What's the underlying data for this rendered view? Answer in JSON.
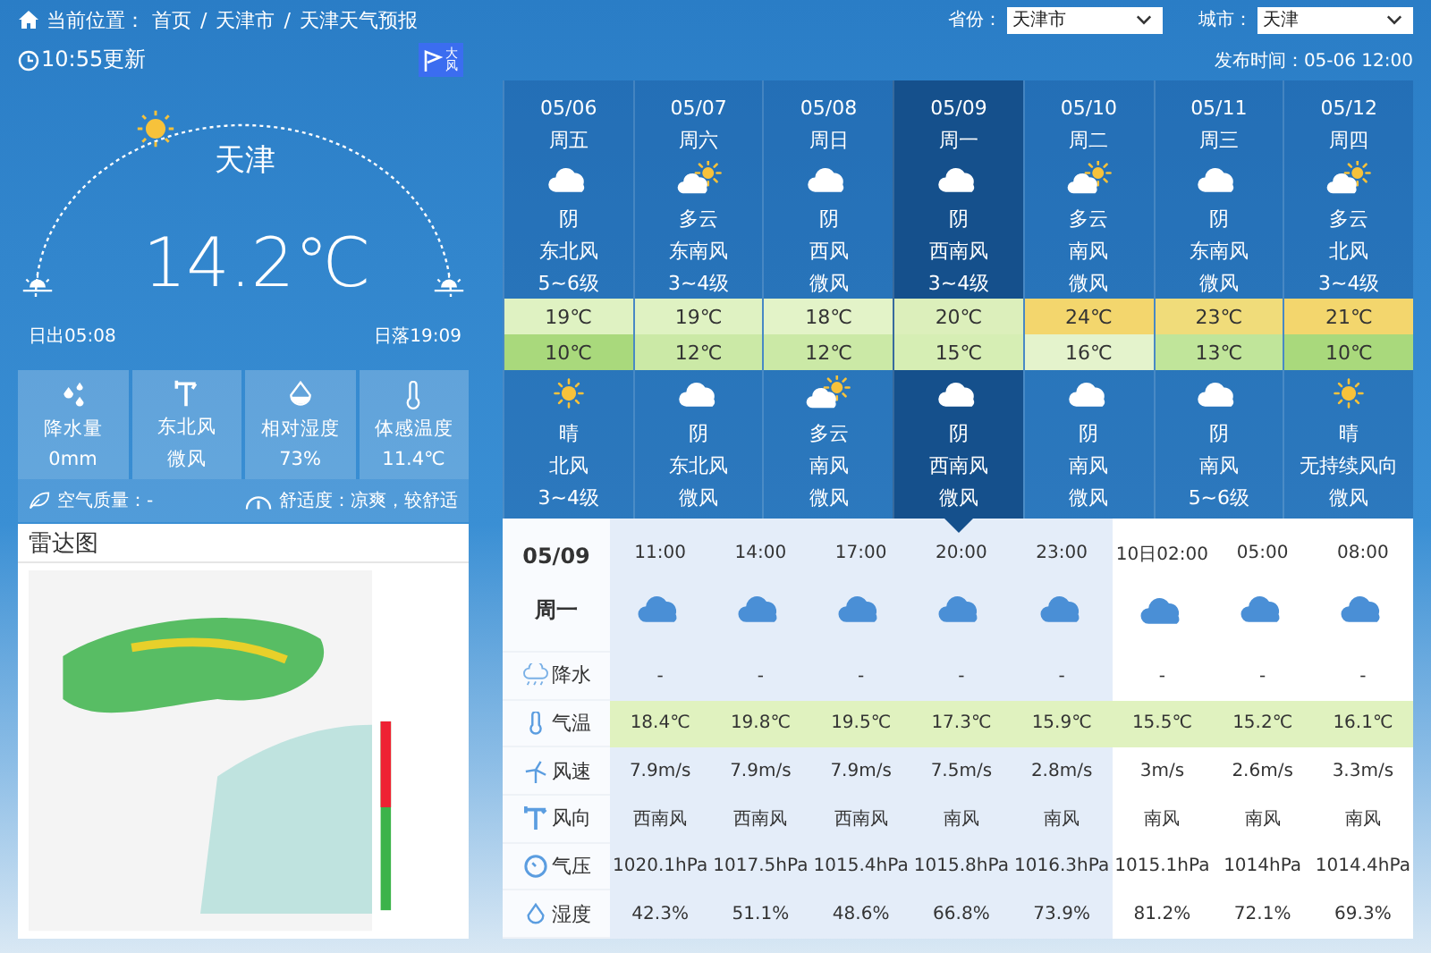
{
  "breadcrumb": {
    "label": "当前位置：",
    "items": [
      "首页",
      "天津市",
      "天津天气预报"
    ],
    "separator": "/"
  },
  "selects": [
    {
      "label": "省份：",
      "value": "天津市"
    },
    {
      "label": "城市：",
      "value": "天津"
    }
  ],
  "update_time": "10:55更新",
  "warning": {
    "text": "大风"
  },
  "publish_time": "发布时间：05-06 12:00",
  "current": {
    "city": "天津",
    "temperature": "14.2℃",
    "sunrise": "日出05:08",
    "sunset": "日落19:09"
  },
  "stats": [
    {
      "kind": "rain",
      "label": "降水量",
      "value": "0mm"
    },
    {
      "kind": "wind",
      "label": "东北风",
      "value": "微风"
    },
    {
      "kind": "humidity",
      "label": "相对湿度",
      "value": "73%"
    },
    {
      "kind": "feel",
      "label": "体感温度",
      "value": "11.4℃"
    }
  ],
  "air_quality": "空气质量：-",
  "comfort": "舒适度：凉爽，较舒适",
  "radar": {
    "title": "雷达图"
  },
  "days": [
    {
      "date": "05/06",
      "weekday": "周五",
      "selected": false,
      "day": {
        "kind": "cloudy",
        "weather": "阴",
        "wind_dir": "东北风",
        "wind_level": "5~6级"
      },
      "high": {
        "text": "19℃",
        "color": "#dff2c2"
      },
      "low": {
        "text": "10℃",
        "color": "#a9d97c"
      },
      "night": {
        "kind": "sunny",
        "weather": "晴",
        "wind_dir": "北风",
        "wind_level": "3~4级"
      }
    },
    {
      "date": "05/07",
      "weekday": "周六",
      "selected": false,
      "day": {
        "kind": "partly_cloudy",
        "weather": "多云",
        "wind_dir": "东南风",
        "wind_level": "3~4级"
      },
      "high": {
        "text": "19℃",
        "color": "#dff2c2"
      },
      "low": {
        "text": "12℃",
        "color": "#cbe9a6"
      },
      "night": {
        "kind": "cloudy",
        "weather": "阴",
        "wind_dir": "东北风",
        "wind_level": "微风"
      }
    },
    {
      "date": "05/08",
      "weekday": "周日",
      "selected": false,
      "day": {
        "kind": "cloudy",
        "weather": "阴",
        "wind_dir": "西风",
        "wind_level": "微风"
      },
      "high": {
        "text": "18℃",
        "color": "#e3f3c8"
      },
      "low": {
        "text": "12℃",
        "color": "#cbe9a6"
      },
      "night": {
        "kind": "partly_cloudy",
        "weather": "多云",
        "wind_dir": "南风",
        "wind_level": "微风"
      }
    },
    {
      "date": "05/09",
      "weekday": "周一",
      "selected": true,
      "day": {
        "kind": "cloudy",
        "weather": "阴",
        "wind_dir": "西南风",
        "wind_level": "3~4级"
      },
      "high": {
        "text": "20℃",
        "color": "#dcefbb"
      },
      "low": {
        "text": "15℃",
        "color": "#d6eeb4"
      },
      "night": {
        "kind": "cloudy",
        "weather": "阴",
        "wind_dir": "西南风",
        "wind_level": "微风"
      }
    },
    {
      "date": "05/10",
      "weekday": "周二",
      "selected": false,
      "day": {
        "kind": "partly_cloudy",
        "weather": "多云",
        "wind_dir": "南风",
        "wind_level": "微风"
      },
      "high": {
        "text": "24℃",
        "color": "#f3d66d"
      },
      "low": {
        "text": "16℃",
        "color": "#e4f3cc"
      },
      "night": {
        "kind": "cloudy",
        "weather": "阴",
        "wind_dir": "南风",
        "wind_level": "微风"
      }
    },
    {
      "date": "05/11",
      "weekday": "周三",
      "selected": false,
      "day": {
        "kind": "cloudy",
        "weather": "阴",
        "wind_dir": "东南风",
        "wind_level": "微风"
      },
      "high": {
        "text": "23℃",
        "color": "#f0dc7a"
      },
      "low": {
        "text": "13℃",
        "color": "#c0e59a"
      },
      "night": {
        "kind": "cloudy",
        "weather": "阴",
        "wind_dir": "南风",
        "wind_level": "5~6级"
      }
    },
    {
      "date": "05/12",
      "weekday": "周四",
      "selected": false,
      "day": {
        "kind": "partly_cloudy",
        "weather": "多云",
        "wind_dir": "北风",
        "wind_level": "3~4级"
      },
      "high": {
        "text": "21℃",
        "color": "#f3d66d"
      },
      "low": {
        "text": "10℃",
        "color": "#a9d97c"
      },
      "night": {
        "kind": "sunny",
        "weather": "晴",
        "wind_dir": "无持续风向",
        "wind_level": "微风"
      }
    }
  ],
  "hourly": {
    "date": "05/09",
    "weekday": "周一",
    "columns": [
      {
        "time": "11:00",
        "kind": "cloudy",
        "selected_day": true
      },
      {
        "time": "14:00",
        "kind": "cloudy",
        "selected_day": true
      },
      {
        "time": "17:00",
        "kind": "cloudy",
        "selected_day": true
      },
      {
        "time": "20:00",
        "kind": "cloudy",
        "selected_day": true
      },
      {
        "time": "23:00",
        "kind": "cloudy",
        "selected_day": true
      },
      {
        "time": "10日02:00",
        "kind": "cloudy",
        "selected_day": false
      },
      {
        "time": "05:00",
        "kind": "cloudy",
        "selected_day": false
      },
      {
        "time": "08:00",
        "kind": "cloudy",
        "selected_day": false
      }
    ],
    "rows": [
      {
        "kind": "precip",
        "label": "降水",
        "values": [
          "-",
          "-",
          "-",
          "-",
          "-",
          "-",
          "-",
          "-"
        ]
      },
      {
        "kind": "temp",
        "label": "气温",
        "values": [
          "18.4℃",
          "19.8℃",
          "19.5℃",
          "17.3℃",
          "15.9℃",
          "15.5℃",
          "15.2℃",
          "16.1℃"
        ]
      },
      {
        "kind": "speed",
        "label": "风速",
        "values": [
          "7.9m/s",
          "7.9m/s",
          "7.9m/s",
          "7.5m/s",
          "2.8m/s",
          "3m/s",
          "2.6m/s",
          "3.3m/s"
        ]
      },
      {
        "kind": "direction",
        "label": "风向",
        "values": [
          "西南风",
          "西南风",
          "西南风",
          "南风",
          "南风",
          "南风",
          "南风",
          "南风"
        ]
      },
      {
        "kind": "pressure",
        "label": "气压",
        "values": [
          "1020.1hPa",
          "1017.5hPa",
          "1015.4hPa",
          "1015.8hPa",
          "1016.3hPa",
          "1015.1hPa",
          "1014hPa",
          "1014.4hPa"
        ]
      },
      {
        "kind": "humidity",
        "label": "湿度",
        "values": [
          "42.3%",
          "51.1%",
          "48.6%",
          "66.8%",
          "73.9%",
          "81.2%",
          "72.1%",
          "69.3%"
        ]
      }
    ]
  }
}
